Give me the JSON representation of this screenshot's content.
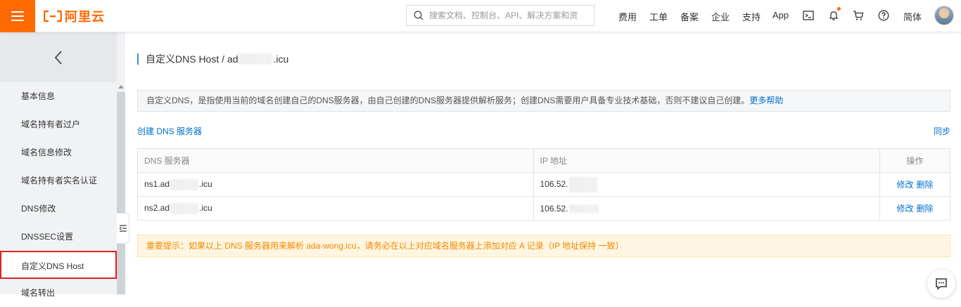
{
  "header": {
    "logo_text": "阿里云",
    "search_placeholder": "搜索文档、控制台、API、解决方案和资",
    "nav": [
      "费用",
      "工单",
      "备案",
      "企业",
      "支持",
      "App"
    ],
    "lang": "简体",
    "icons": [
      "menu-icon",
      "search-icon",
      "terminal-icon",
      "bell-icon",
      "cart-icon",
      "help-icon",
      "avatar"
    ],
    "brand_color": "#ff6a00"
  },
  "sidebar": {
    "back_icon": "chevron-left-icon",
    "items": [
      {
        "label": "基本信息"
      },
      {
        "label": "域名持有者过户"
      },
      {
        "label": "域名信息修改"
      },
      {
        "label": "域名持有者实名认证"
      },
      {
        "label": "DNS修改"
      },
      {
        "label": "DNSSEC设置"
      },
      {
        "label": "自定义DNS Host"
      },
      {
        "label": "域名转出"
      }
    ],
    "active_index": 6
  },
  "main": {
    "title_prefix": "自定义DNS Host / ad",
    "title_suffix": ".icu",
    "notice_text": "自定义DNS，是指使用当前的域名创建自己的DNS服务器，由自己创建的DNS服务器提供解析服务；创建DNS需要用户具备专业技术基础，否则不建议自己创建。",
    "notice_link": "更多帮助",
    "create_link": "创建 DNS 服务器",
    "sync_link": "同步",
    "table": {
      "headers": [
        "DNS 服务器",
        "IP 地址",
        "操作"
      ],
      "rows": [
        {
          "dns_prefix": "ns1.ad",
          "dns_suffix": ".icu",
          "ip_prefix": "106.52.",
          "edit": "修改",
          "delete": "删除"
        },
        {
          "dns_prefix": "ns2.ad",
          "dns_suffix": ".icu",
          "ip_prefix": "106.52.",
          "edit": "修改",
          "delete": "删除"
        }
      ]
    },
    "warning": "重要提示：如果以上 DNS 服务器用来解析 ada-wong.icu，请务必在以上对应域名服务器上添加对应 A 记录（IP 地址保持 一致）",
    "link_color": "#0070cc",
    "warning_color": "#f08a00"
  }
}
